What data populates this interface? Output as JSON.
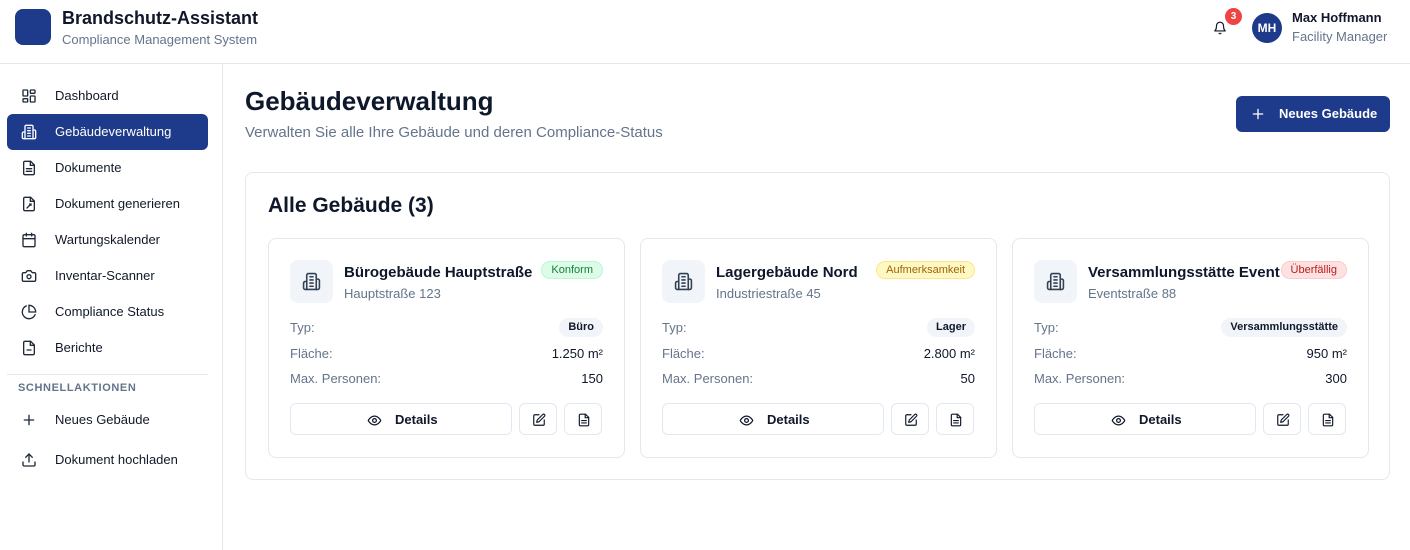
{
  "header": {
    "app_title": "Brandschutz-Assistant",
    "app_subtitle": "Compliance Management System",
    "notification_count": "3",
    "user": {
      "initials": "MH",
      "name": "Max Hoffmann",
      "role": "Facility Manager"
    }
  },
  "sidebar": {
    "items": [
      {
        "label": "Dashboard",
        "icon": "dashboard-icon"
      },
      {
        "label": "Gebäudeverwaltung",
        "icon": "building-icon",
        "active": true
      },
      {
        "label": "Dokumente",
        "icon": "document-icon"
      },
      {
        "label": "Dokument generieren",
        "icon": "document-generate-icon"
      },
      {
        "label": "Wartungskalender",
        "icon": "calendar-icon"
      },
      {
        "label": "Inventar-Scanner",
        "icon": "camera-icon"
      },
      {
        "label": "Compliance Status",
        "icon": "pie-chart-icon"
      },
      {
        "label": "Berichte",
        "icon": "report-icon"
      }
    ],
    "quick_actions_title": "SCHNELLAKTIONEN",
    "quick_actions": [
      {
        "label": "Neues Gebäude",
        "icon": "plus-icon"
      },
      {
        "label": "Dokument hochladen",
        "icon": "upload-icon"
      }
    ]
  },
  "main": {
    "title": "Gebäudeverwaltung",
    "subtitle": "Verwalten Sie alle Ihre Gebäude und deren Compliance-Status",
    "new_building_button": "Neues Gebäude",
    "panel_title": "Alle Gebäude (3)",
    "field_labels": {
      "type": "Typ:",
      "area": "Fläche:",
      "max_persons": "Max. Personen:"
    },
    "details_label": "Details",
    "buildings": [
      {
        "name": "Bürogebäude Hauptstraße",
        "address": "Hauptstraße 123",
        "status": "Konform",
        "status_color": "#15803d",
        "type": "Büro",
        "area": "1.250 m²",
        "max_persons": "150"
      },
      {
        "name": "Lagergebäude Nord",
        "address": "Industriestraße 45",
        "status": "Aufmerksamkeit",
        "status_color": "#a16207",
        "type": "Lager",
        "area": "2.800 m²",
        "max_persons": "50"
      },
      {
        "name": "Versammlungsstätte Event",
        "address": "Eventstraße 88",
        "status": "Überfällig",
        "status_color": "#b91c1c",
        "type": "Versammlungsstätte",
        "area": "950 m²",
        "max_persons": "300"
      }
    ]
  },
  "colors": {
    "primary": "#1e3a8a",
    "badge": "#ef4444",
    "muted_text": "#64748b",
    "border": "#e5e7eb"
  }
}
